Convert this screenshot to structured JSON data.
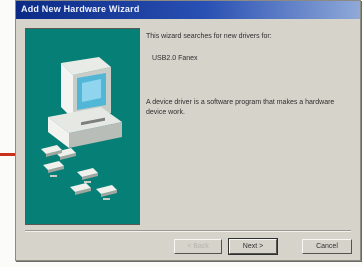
{
  "dialog": {
    "title": "Add New Hardware Wizard",
    "intro_text": "This wizard searches for new drivers for:",
    "device_name": "USB2.0 Fanex",
    "driver_text": "A device driver is a software program that makes a hardware device work."
  },
  "buttons": {
    "back": "< Back",
    "next": "Next >",
    "cancel": "Cancel"
  },
  "colors": {
    "title_bar": "#0b2a86",
    "art_background": "#067f76",
    "dialog_face": "#d6d3cb",
    "accent_rule": "#c8321c"
  },
  "icons": {
    "wizard_art": "computer-icon",
    "device_stack": "hardware-cards-icon"
  }
}
